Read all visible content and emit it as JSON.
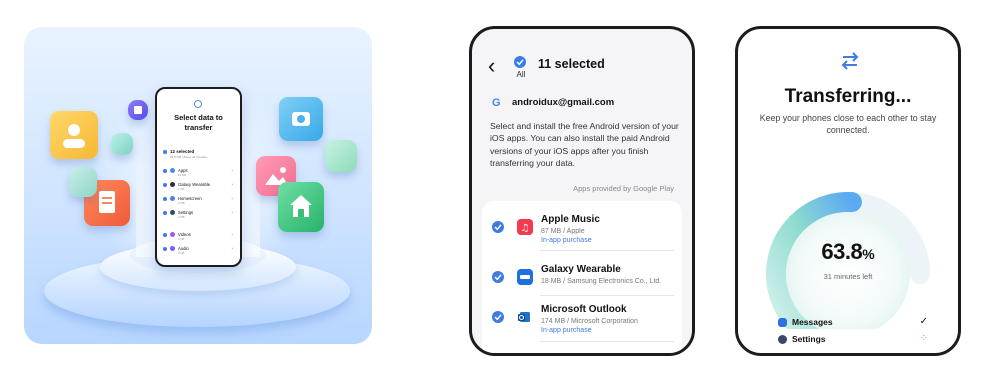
{
  "illustration": {
    "phone": {
      "title_line1": "Select data to",
      "title_line2": "transfer",
      "selected": "12 selected",
      "selected_sub": "24.5 GB / About 49 minutes",
      "items": [
        {
          "label": "Apps",
          "sub": "12 GB"
        },
        {
          "label": "Galaxy Wearable",
          "sub": "2 GB"
        },
        {
          "label": "Homescreen",
          "sub": "2 MB"
        },
        {
          "label": "Settings",
          "sub": "2 MB"
        },
        {
          "label": "Videos",
          "sub": "4 GB"
        },
        {
          "label": "Audio",
          "sub": "2 GB"
        }
      ]
    }
  },
  "apps_screen": {
    "back_icon": "chevron-left-icon",
    "all_label": "All",
    "title": "11 selected",
    "account": "androidux@gmail.com",
    "description": "Select and install the free Android version of your iOS apps. You can also install the paid Android versions of your iOS apps after you finish transferring your data.",
    "provided_by": "Apps provided by Google Play",
    "apps": [
      {
        "name": "Apple Music",
        "meta": "87 MB / Apple",
        "note": "In-app purchase",
        "color": "#f33a4e",
        "checked": true
      },
      {
        "name": "Galaxy Wearable",
        "meta": "18 MB / Samsung Electronics Co., Ltd.",
        "note": "",
        "color": "#1f6fe0",
        "checked": true
      },
      {
        "name": "Microsoft Outlook",
        "meta": "174 MB / Microsoft Corporation",
        "note": "In-app purchase",
        "color": "#1a73c9",
        "checked": true
      }
    ]
  },
  "transfer_screen": {
    "icon": "transfer-arrows-icon",
    "title": "Transferring...",
    "subtitle": "Keep your phones close to each other to stay connected.",
    "percent_value": "63.8",
    "percent_sign": "%",
    "progress_fraction": 0.638,
    "time_left": "31 minutes left",
    "items": [
      {
        "label": "Messages",
        "status": "✓",
        "color": "#2f6fe0"
      },
      {
        "label": "Settings",
        "status": "⁘",
        "color": "#3a4a66"
      }
    ]
  }
}
